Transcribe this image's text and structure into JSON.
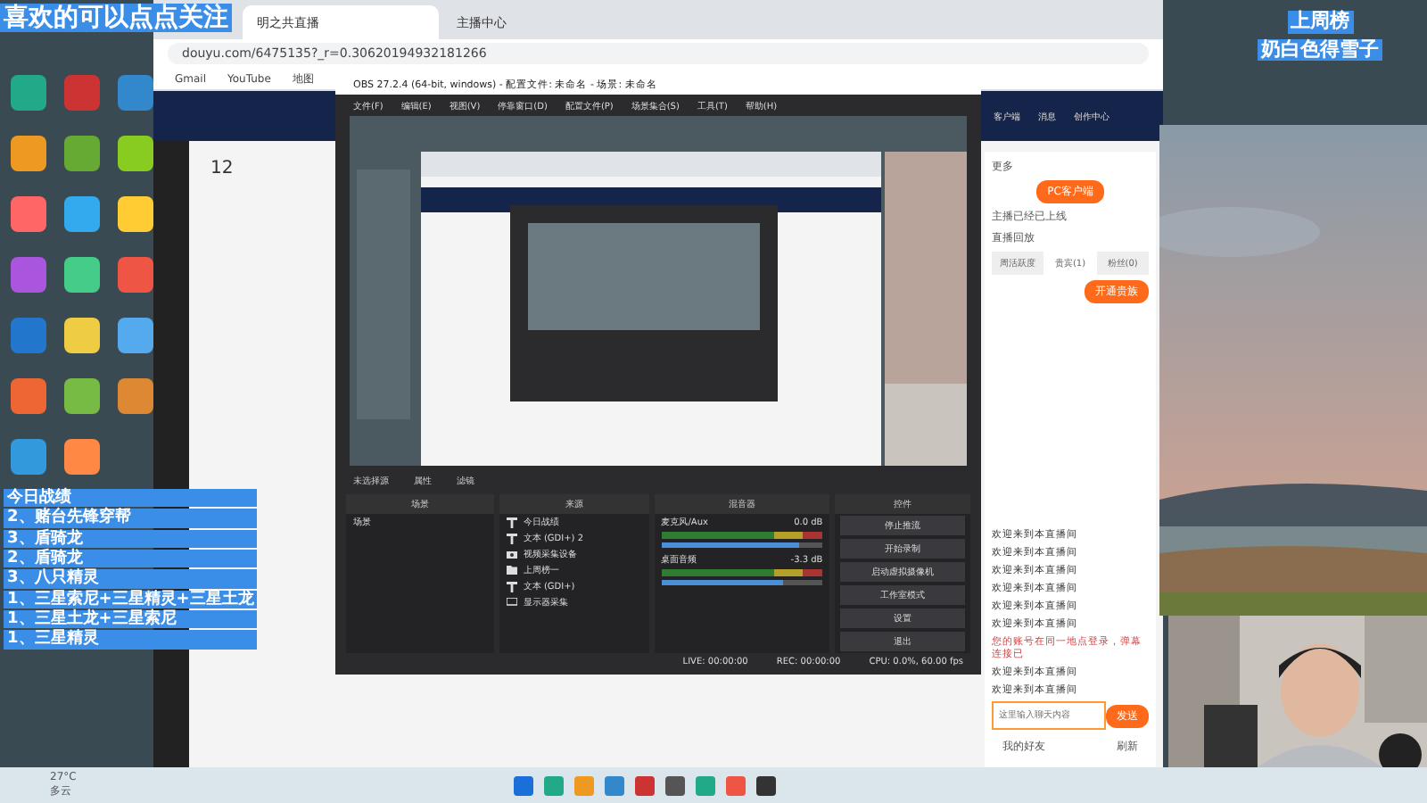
{
  "overlay": {
    "follow_banner": "喜欢的可以点点关注",
    "stats_lines": [
      "今日战绩",
      "2、赌台先锋穿帮",
      "3、盾骑龙",
      "2、盾骑龙",
      "3、八只精灵",
      "1、三星索尼+三星精灵+三星土龙",
      "1、三星土龙+三星索尼",
      "1、三星精灵"
    ],
    "weekly_top": {
      "label": "上周榜",
      "name": "奶白色得雪子"
    }
  },
  "browser": {
    "tabs": [
      {
        "label": "明之共直播",
        "selected": true
      },
      {
        "label": "主播中心",
        "selected": false
      }
    ],
    "url": "douyu.com/6475135?_r=0.30620194932181266",
    "bookmarks": [
      "Gmail",
      "YouTube",
      "地图"
    ],
    "site": {
      "nav": [
        "客户端",
        "消息",
        "创作中心"
      ],
      "count": "12",
      "more": "更多",
      "client_button": "PC客户端",
      "client_note": "主播已经已上线",
      "replay": "直播回放",
      "tabs": [
        {
          "label": "周活跃度",
          "selected": false
        },
        {
          "label": "贵宾(1)",
          "selected": true
        },
        {
          "label": "粉丝(0)",
          "selected": false
        }
      ],
      "vip_button": "开通贵族",
      "chat": [
        {
          "kind": "message",
          "text": "欢迎来到本直播间"
        },
        {
          "kind": "message",
          "text": "欢迎来到本直播间"
        },
        {
          "kind": "message",
          "text": "欢迎来到本直播间"
        },
        {
          "kind": "message",
          "text": "欢迎来到本直播间"
        },
        {
          "kind": "message",
          "text": "欢迎来到本直播间"
        },
        {
          "kind": "message",
          "text": "欢迎来到本直播间"
        },
        {
          "kind": "notice",
          "text": "您的账号在同一地点登录，弹幕连接已"
        },
        {
          "kind": "message",
          "text": "欢迎来到本直播间"
        },
        {
          "kind": "message",
          "text": "欢迎来到本直播间"
        }
      ],
      "chat_input": {
        "placeholder": "这里输入聊天内容"
      },
      "send": "发送",
      "friends": "我的好友",
      "refresh": "刷新"
    }
  },
  "obs": {
    "title": "OBS 27.2.4 (64-bit, windows) - 配置文件: 未命名 - 场景: 未命名",
    "menu": [
      "文件(F)",
      "编辑(E)",
      "视图(V)",
      "停靠窗口(D)",
      "配置文件(P)",
      "场景集合(S)",
      "工具(T)",
      "帮助(H)"
    ],
    "no_source": "未选择源",
    "source_buttons": [
      "属性",
      "滤镜"
    ],
    "scenes": {
      "title": "场景",
      "items": [
        "场景"
      ]
    },
    "sources": {
      "title": "来源",
      "items": [
        {
          "kind": "text",
          "label": "今日战绩"
        },
        {
          "kind": "text",
          "label": "文本 (GDI+) 2"
        },
        {
          "kind": "camera",
          "label": "视频采集设备"
        },
        {
          "kind": "folder",
          "label": "上周榜一"
        },
        {
          "kind": "text",
          "label": "文本 (GDI+)"
        },
        {
          "kind": "display",
          "label": "显示器采集"
        }
      ]
    },
    "mixer": {
      "title": "混音器",
      "channels": [
        {
          "name": "麦克风/Aux",
          "reading": "0.0 dB",
          "level": 0.85
        },
        {
          "name": "桌面音频",
          "reading": "-3.3 dB",
          "level": 0.75
        }
      ]
    },
    "controls": {
      "title": "控件",
      "buttons": [
        "停止推流",
        "开始录制",
        "启动虚拟摄像机",
        "工作室模式",
        "设置",
        "退出"
      ]
    },
    "status": [
      "LIVE: 00:00:00",
      "REC: 00:00:00",
      "CPU: 0.0%, 60.00 fps"
    ]
  },
  "taskbar": {
    "temperature": "27°C",
    "weather": "多云"
  }
}
